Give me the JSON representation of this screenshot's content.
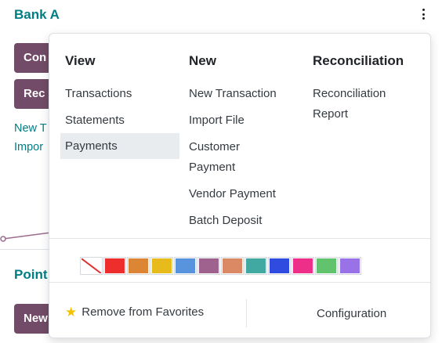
{
  "card": {
    "title": "Bank A",
    "buttons": [
      "Con",
      "Rec",
      "New"
    ],
    "links": [
      "New T",
      "Impor"
    ],
    "section_title": "Point"
  },
  "dropdown": {
    "columns": [
      {
        "heading": "View",
        "items": [
          "Transactions",
          "Statements",
          "Payments"
        ],
        "active": "Payments"
      },
      {
        "heading": "New",
        "items": [
          "New Transaction",
          "Import File",
          "Customer",
          "Payment",
          "Vendor Payment",
          "Batch Deposit"
        ]
      },
      {
        "heading": "Reconciliation",
        "items": [
          "Reconciliation",
          "Report"
        ]
      }
    ],
    "colors": [
      "none",
      "#ee2d2d",
      "#dc8534",
      "#e8bb1d",
      "#5794dd",
      "#9f628f",
      "#db8865",
      "#41a9a2",
      "#304be0",
      "#ee2f8a",
      "#61c36e",
      "#9872e6"
    ],
    "favorite_label": "Remove from Favorites",
    "favorite_icon": "star-icon",
    "config_label": "Configuration"
  }
}
